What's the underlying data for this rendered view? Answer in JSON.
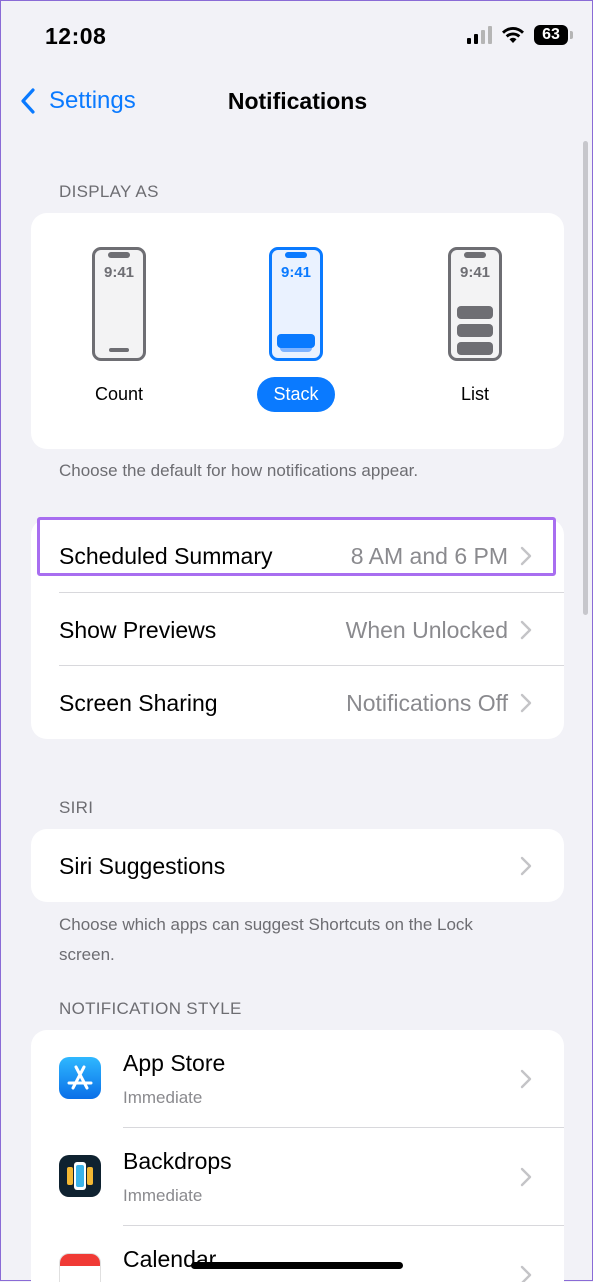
{
  "status": {
    "time": "12:08",
    "battery": "63"
  },
  "nav": {
    "back_label": "Settings",
    "title": "Notifications"
  },
  "display_as": {
    "header": "DISPLAY AS",
    "options": [
      {
        "label": "Count",
        "phone_time": "9:41",
        "selected": false
      },
      {
        "label": "Stack",
        "phone_time": "9:41",
        "selected": true
      },
      {
        "label": "List",
        "phone_time": "9:41",
        "selected": false
      }
    ],
    "footnote": "Choose the default for how notifications appear."
  },
  "settings_rows": [
    {
      "label": "Scheduled Summary",
      "value": "8 AM and 6 PM"
    },
    {
      "label": "Show Previews",
      "value": "When Unlocked"
    },
    {
      "label": "Screen Sharing",
      "value": "Notifications Off"
    }
  ],
  "siri": {
    "header": "SIRI",
    "row_label": "Siri Suggestions",
    "footnote": "Choose which apps can suggest Shortcuts on the Lock screen."
  },
  "notification_style": {
    "header": "NOTIFICATION STYLE",
    "apps": [
      {
        "name": "App Store",
        "subtitle": "Immediate",
        "icon": "app-store-icon"
      },
      {
        "name": "Backdrops",
        "subtitle": "Immediate",
        "icon": "backdrops-icon"
      },
      {
        "name": "Calendar",
        "subtitle": "",
        "icon": "calendar-icon"
      }
    ]
  },
  "colors": {
    "accent": "#0a7aff",
    "highlight": "#a86ef0",
    "background": "#f2f2f7"
  }
}
